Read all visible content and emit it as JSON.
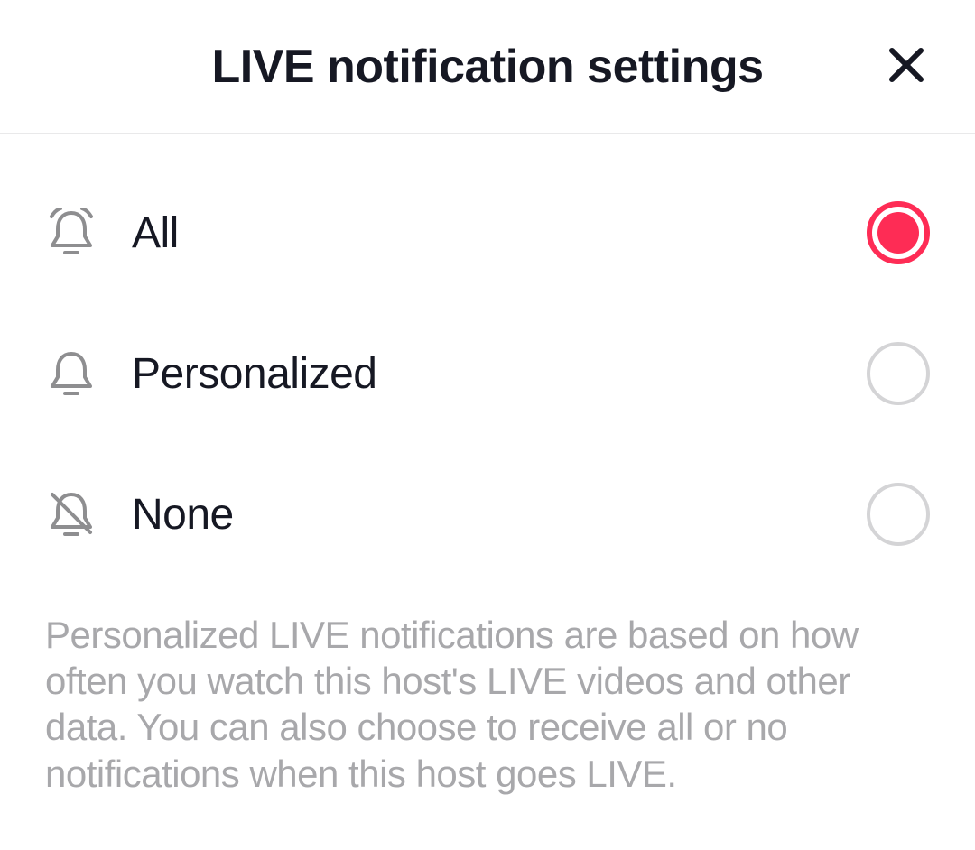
{
  "header": {
    "title": "LIVE notification settings"
  },
  "options": [
    {
      "key": "all",
      "label": "All",
      "selected": true
    },
    {
      "key": "personalized",
      "label": "Personalized",
      "selected": false
    },
    {
      "key": "none",
      "label": "None",
      "selected": false
    }
  ],
  "description": "Personalized LIVE notifications are based on how often you watch this host's LIVE videos and other data. You can also choose to receive all or no notifications when this host goes LIVE."
}
